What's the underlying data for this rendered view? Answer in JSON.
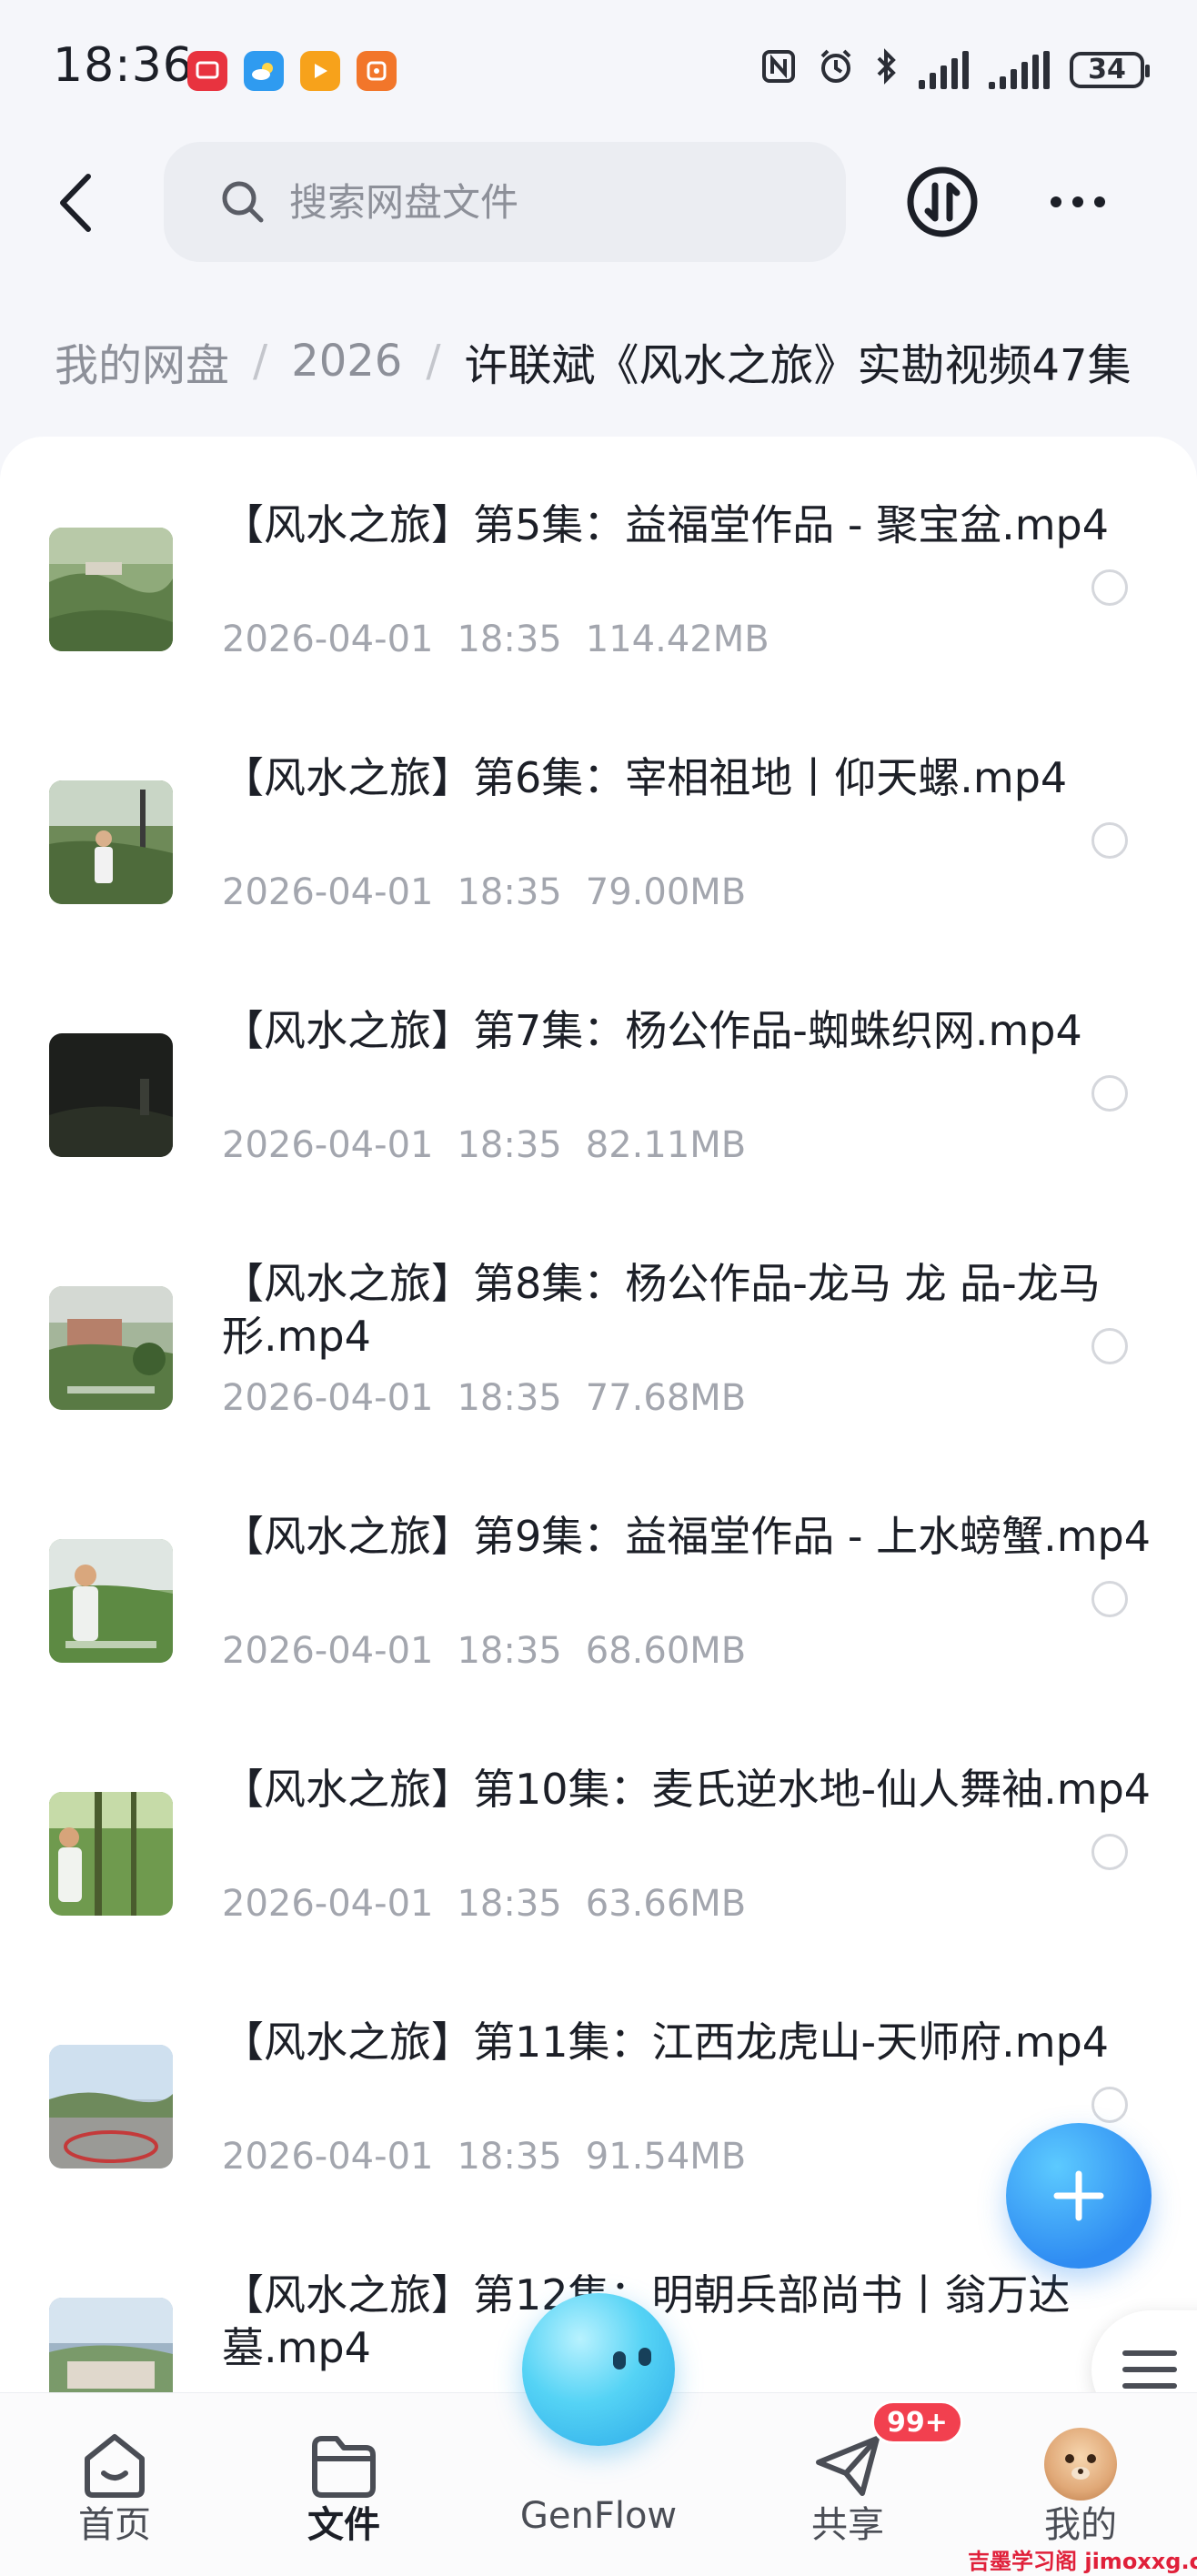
{
  "status_bar": {
    "time": "18:36",
    "battery": "34",
    "icons": [
      "nfc-icon",
      "alarm-icon",
      "bluetooth-icon",
      "signal-icon",
      "signal-icon",
      "battery-icon"
    ]
  },
  "header": {
    "search_placeholder": "搜索网盘文件"
  },
  "breadcrumb": {
    "items": [
      "我的网盘",
      "2026"
    ],
    "current": "许联斌《风水之旅》实勘视频47集"
  },
  "files": [
    {
      "name": "【风水之旅】第5集：益福堂作品 - 聚宝盆.mp4",
      "date": "2026-04-01",
      "time": "18:35",
      "size": "114.42MB"
    },
    {
      "name": "【风水之旅】第6集：宰相祖地丨仰天螺.mp4",
      "date": "2026-04-01",
      "time": "18:35",
      "size": "79.00MB"
    },
    {
      "name": "【风水之旅】第7集：杨公作品-蜘蛛织网.mp4",
      "date": "2026-04-01",
      "time": "18:35",
      "size": "82.11MB"
    },
    {
      "name": "【风水之旅】第8集：杨公作品-龙马 龙 品-龙马形.mp4",
      "date": "2026-04-01",
      "time": "18:35",
      "size": "77.68MB"
    },
    {
      "name": "【风水之旅】第9集：益福堂作品 - 上水螃蟹.mp4",
      "date": "2026-04-01",
      "time": "18:35",
      "size": "68.60MB"
    },
    {
      "name": "【风水之旅】第10集：麦氏逆水地-仙人舞袖.mp4",
      "date": "2026-04-01",
      "time": "18:35",
      "size": "63.66MB"
    },
    {
      "name": "【风水之旅】第11集：江西龙虎山-天师府.mp4",
      "date": "2026-04-01",
      "time": "18:35",
      "size": "91.54MB"
    },
    {
      "name": "【风水之旅】第12集：明朝兵部尚书丨翁万达墓.mp4",
      "date": "",
      "time": "",
      "size": ""
    }
  ],
  "bottom_nav": {
    "tabs": [
      {
        "label": "首页"
      },
      {
        "label": "文件"
      },
      {
        "label": "GenFlow"
      },
      {
        "label": "共享"
      },
      {
        "label": "我的"
      }
    ],
    "share_badge": "99+"
  },
  "watermark": "吉墨学习阁 jimoxxg.com",
  "colors": {
    "accent": "#2f8cf2",
    "badge": "#f2404f",
    "background": "#f5f6fa"
  }
}
